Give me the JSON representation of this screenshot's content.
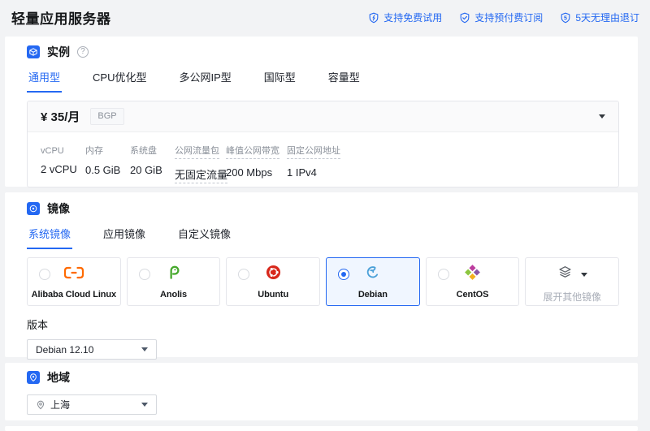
{
  "colors": {
    "accent": "#2468F2",
    "selected_card_bg": "#F0F6FF",
    "alibaba_orange": "#FF6A00",
    "anolis_green": "#46A82C",
    "ubuntu_orange": "#E95420",
    "debian_blue": "#4BA0D8",
    "centos_colors": [
      "#BC3C9E",
      "#8956A8",
      "#F2B01E",
      "#8CC63F"
    ]
  },
  "topbar": {
    "title": "轻量应用服务器",
    "badges": [
      {
        "icon": "shield-lightning-icon",
        "label": "支持免费试用"
      },
      {
        "icon": "shield-check-icon",
        "label": "支持预付费订阅"
      },
      {
        "icon": "shield-5-icon",
        "label": "5天无理由退订"
      }
    ]
  },
  "instance": {
    "title": "实例",
    "tabs": [
      {
        "label": "通用型",
        "active": true
      },
      {
        "label": "CPU优化型",
        "active": false
      },
      {
        "label": "多公网IP型",
        "active": false
      },
      {
        "label": "国际型",
        "active": false
      },
      {
        "label": "容量型",
        "active": false
      }
    ],
    "plan": {
      "price": "¥ 35/月",
      "network_tag": "BGP",
      "specs": [
        {
          "label": "vCPU",
          "value": "2 vCPU"
        },
        {
          "label": "内存",
          "value": "0.5 GiB"
        },
        {
          "label": "系统盘",
          "value": "20 GiB"
        },
        {
          "label": "公网流量包",
          "value": "无固定流量"
        },
        {
          "label": "峰值公网带宽",
          "value": "200 Mbps"
        },
        {
          "label": "固定公网地址",
          "value": "1 IPv4"
        }
      ]
    }
  },
  "image": {
    "title": "镜像",
    "tabs": [
      {
        "label": "系统镜像",
        "active": true
      },
      {
        "label": "应用镜像",
        "active": false
      },
      {
        "label": "自定义镜像",
        "active": false
      }
    ],
    "os_options": [
      {
        "name": "Alibaba Cloud Linux",
        "icon": "alibaba-cloud-linux-logo",
        "selected": false
      },
      {
        "name": "Anolis",
        "icon": "anolis-logo",
        "selected": false
      },
      {
        "name": "Ubuntu",
        "icon": "ubuntu-logo",
        "selected": false
      },
      {
        "name": "Debian",
        "icon": "debian-logo",
        "selected": true
      },
      {
        "name": "CentOS",
        "icon": "centos-logo",
        "selected": false
      },
      {
        "name": "展开其他镜像",
        "icon": "layers-icon",
        "expander": true
      }
    ],
    "version_label": "版本",
    "version_value": "Debian 12.10"
  },
  "region": {
    "title": "地域",
    "value": "上海"
  }
}
